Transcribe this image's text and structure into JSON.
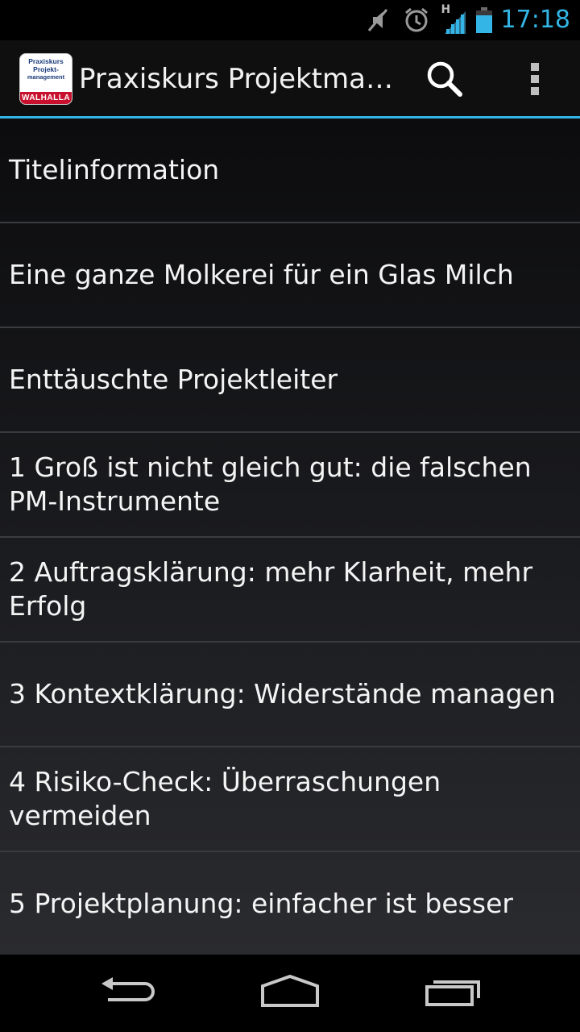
{
  "status_bar": {
    "time": "17:18",
    "network_type": "H",
    "icons": [
      "mute-icon",
      "alarm-icon",
      "signal-icon",
      "battery-icon"
    ]
  },
  "action_bar": {
    "title": "Praxiskurs Projektma…",
    "app_icon": {
      "line1": "Praxiskurs",
      "line2": "Projekt-",
      "line3": "management",
      "brand": "WALHALLA"
    },
    "accent_color": "#33b5e5"
  },
  "list": {
    "items": [
      {
        "label": "Titelinformation"
      },
      {
        "label": "Eine ganze Molkerei für ein Glas Milch"
      },
      {
        "label": "Enttäuschte Projektleiter"
      },
      {
        "label": "1 Groß ist nicht gleich gut: die falschen PM-Instrumente"
      },
      {
        "label": "2 Auftragsklärung: mehr Klarheit, mehr Erfolg"
      },
      {
        "label": "3 Kontextklärung: Widerstände managen"
      },
      {
        "label": "4 Risiko-Check: Überraschungen vermeiden"
      },
      {
        "label": "5 Projektplanung: einfacher ist besser"
      }
    ]
  },
  "nav_bar": {
    "icons": [
      "back-icon",
      "home-icon",
      "recent-apps-icon"
    ]
  }
}
